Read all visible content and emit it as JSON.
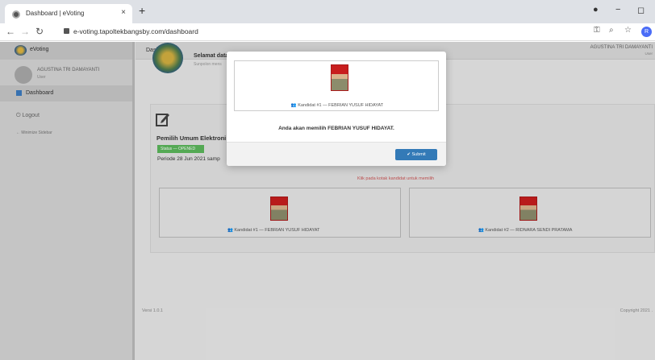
{
  "browser": {
    "tab_title": "Dashboard | eVoting",
    "tab_close": "×",
    "new_tab": "+",
    "url": "e-voting.tapoltekbangsby.com/dashboard",
    "profile_initial": "R"
  },
  "sidebar": {
    "brand": "eVoting",
    "user_name": "AGUSTINA TRI DAMAYANTI",
    "user_role": "User",
    "nav_dashboard": "Dashboard",
    "nav_logout": "Logout",
    "nav_minimize": "Minimize Sidebar"
  },
  "header": {
    "title": "Dashboard",
    "user_name": "AGUSTINA TRI DAMAYANTI",
    "user_role": "User"
  },
  "welcome": {
    "title": "Selamat data",
    "subtitle": "Sunpolon mens"
  },
  "election": {
    "title": "Pemilih Umum Elektroni",
    "status": "Status — OPENED",
    "period": "Periode 28 Jun 2021 samp",
    "instruction": "Klik pada kotak kandidat untuk memilih"
  },
  "candidates": [
    {
      "label": "Kandidat #1 — FEBRIAN YUSUF HIDAYAT"
    },
    {
      "label": "Kandidat #2 — RIDNARA SENDI PRATAMA"
    }
  ],
  "modal": {
    "candidate_label": "Kandidat #1 — FEBRIAN YUSUF HIDAYAT",
    "message": "Anda akan memilih FEBRIAN YUSUF HIDAYAT.",
    "submit": "Submit"
  },
  "footer": {
    "version": "Versi 1.0.1",
    "copyright": "Copyright 2021 ."
  },
  "colors": {
    "primary": "#337ab7",
    "success": "#5cb85c",
    "instruction": "#cc5555"
  }
}
